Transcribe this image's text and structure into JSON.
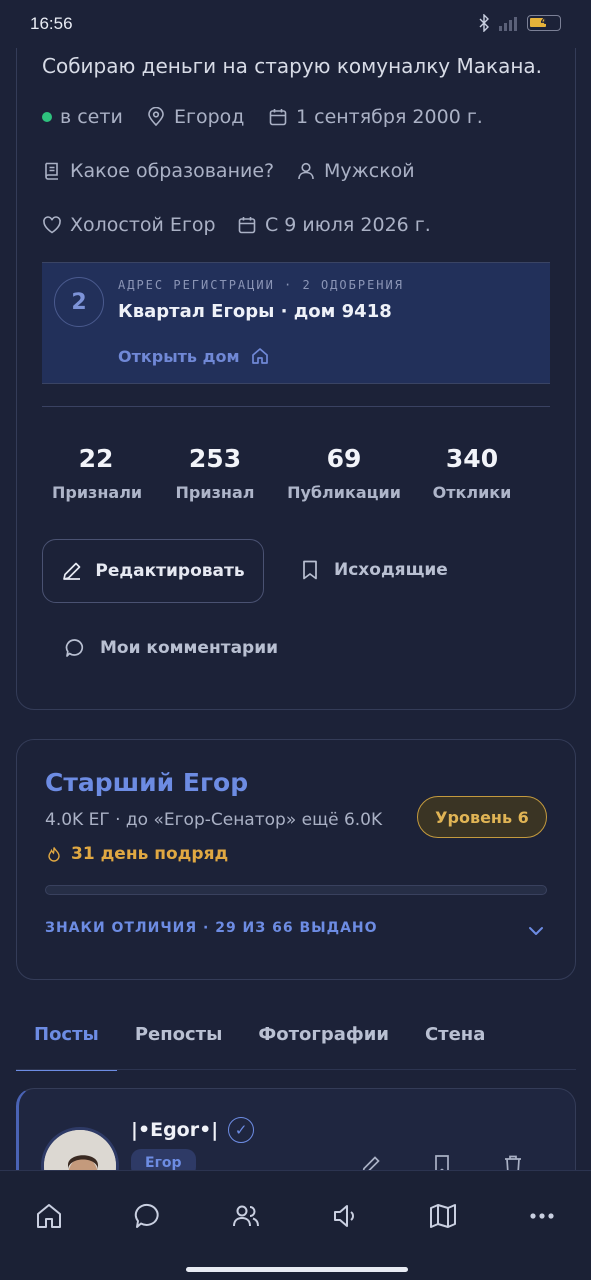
{
  "status_bar": {
    "time": "16:56",
    "battery": "4"
  },
  "profile": {
    "bio": "Собираю деньги на старую комуналку Макана.",
    "online": "в сети",
    "city": "Егород",
    "birthday": "1 сентября 2000 г.",
    "education": "Какое образование?",
    "gender": "Мужской",
    "relationship": "Холостой Егор",
    "joined": "С 9 июля 2026 г."
  },
  "registration": {
    "number": "2",
    "label": "АДРЕС РЕГИСТРАЦИИ · 2 ОДОБРЕНИЯ",
    "address": "Квартал Егоры · дом 9418",
    "open_link": "Открыть дом"
  },
  "stats": [
    {
      "value": "22",
      "label": "Признали"
    },
    {
      "value": "253",
      "label": "Признал"
    },
    {
      "value": "69",
      "label": "Публикации"
    },
    {
      "value": "340",
      "label": "Отклики"
    }
  ],
  "actions": {
    "edit": "Редактировать",
    "outgoing": "Исходящие",
    "my_comments": "Мои комментарии"
  },
  "level": {
    "title": "Старший Егор",
    "progress_text": "4.0K ЕГ · до «Егор-Сенатор» ещё 6.0K",
    "streak": "31 день подряд",
    "badge": "Уровень 6",
    "progress_fraction": 0,
    "badges_label": "ЗНАКИ ОТЛИЧИЯ · 29 ИЗ 66 ВЫДАНО"
  },
  "tabs": [
    {
      "label": "Посты",
      "active": true
    },
    {
      "label": "Репосты",
      "active": false
    },
    {
      "label": "Фотографии",
      "active": false
    },
    {
      "label": "Стена",
      "active": false
    }
  ],
  "post": {
    "author": "|•Egor•|",
    "tag": "Егор"
  },
  "colors": {
    "accent": "#6d8ce3",
    "gold": "#e0b455",
    "online": "#2ec27e",
    "background": "#1c2238"
  },
  "icons": {
    "nav": [
      "home-icon",
      "chat-icon",
      "people-icon",
      "speaker-icon",
      "map-icon",
      "more-icon"
    ]
  }
}
